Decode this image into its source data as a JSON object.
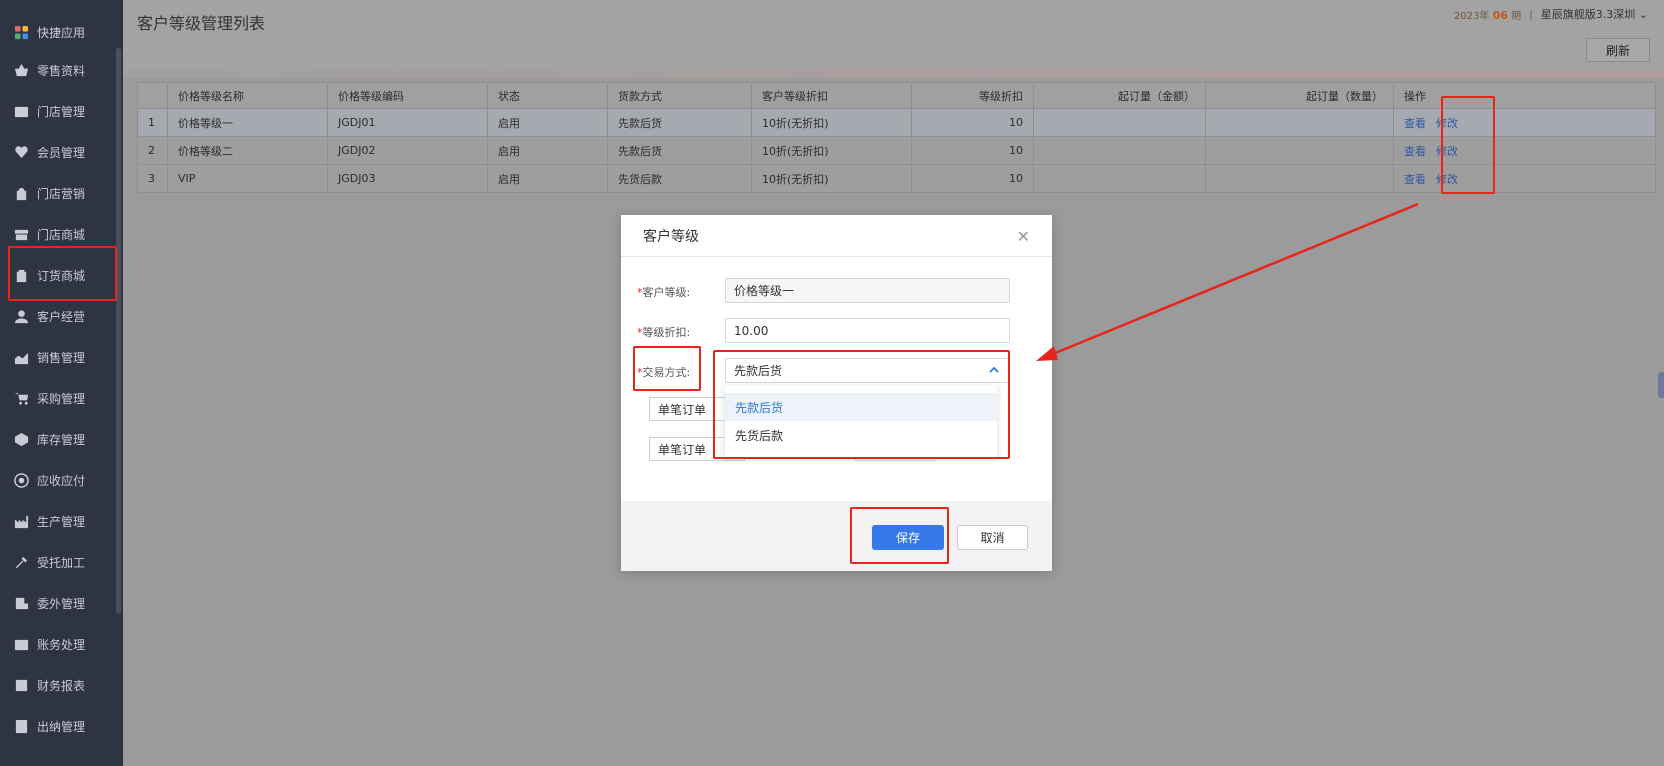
{
  "sidebar": {
    "items": [
      {
        "label": "快捷应用",
        "icon": "apps-icon"
      },
      {
        "label": "零售资料",
        "icon": "basket-icon"
      },
      {
        "label": "门店管理",
        "icon": "store-icon"
      },
      {
        "label": "会员管理",
        "icon": "heart-icon"
      },
      {
        "label": "门店营销",
        "icon": "bag-icon"
      },
      {
        "label": "门店商城",
        "icon": "shop-icon"
      },
      {
        "label": "订货商城",
        "icon": "order-bag-icon"
      },
      {
        "label": "客户经营",
        "icon": "user-icon"
      },
      {
        "label": "销售管理",
        "icon": "chart-icon"
      },
      {
        "label": "采购管理",
        "icon": "cart-icon"
      },
      {
        "label": "库存管理",
        "icon": "box-icon"
      },
      {
        "label": "应收应付",
        "icon": "target-icon"
      },
      {
        "label": "生产管理",
        "icon": "factory-icon"
      },
      {
        "label": "受托加工",
        "icon": "tools-icon"
      },
      {
        "label": "委外管理",
        "icon": "outsource-icon"
      },
      {
        "label": "账务处理",
        "icon": "ledger-icon"
      },
      {
        "label": "财务报表",
        "icon": "report-icon"
      },
      {
        "label": "出纳管理",
        "icon": "cashier-icon"
      }
    ]
  },
  "header": {
    "title": "客户等级管理列表",
    "date_prefix": "2023年",
    "date_day": "06",
    "date_suffix": "期",
    "separator": "|",
    "company": "星辰旗舰版3.3深圳",
    "refresh_label": "刷新"
  },
  "table": {
    "columns": [
      "",
      "价格等级名称",
      "价格等级编码",
      "状态",
      "货款方式",
      "客户等级折扣",
      "等级折扣",
      "起订量（金额）",
      "起订量（数量）",
      "操作"
    ],
    "rows": [
      {
        "no": "1",
        "name": "价格等级一",
        "code": "JGDJ01",
        "status": "启用",
        "payment": "先款后货",
        "discount_text": "10折(无折扣)",
        "discount": "10",
        "min_amount": "",
        "min_qty": "",
        "view": "查看",
        "edit": "修改"
      },
      {
        "no": "2",
        "name": "价格等级二",
        "code": "JGDJ02",
        "status": "启用",
        "payment": "先款后货",
        "discount_text": "10折(无折扣)",
        "discount": "10",
        "min_amount": "",
        "min_qty": "",
        "view": "查看",
        "edit": "修改"
      },
      {
        "no": "3",
        "name": "VIP",
        "code": "JGDJ03",
        "status": "启用",
        "payment": "先货后款",
        "discount_text": "10折(无折扣)",
        "discount": "10",
        "min_amount": "",
        "min_qty": "",
        "view": "查看",
        "edit": "修改"
      }
    ]
  },
  "modal": {
    "title": "客户等级",
    "required_mark": "*",
    "level_label": "客户等级:",
    "level_value": "价格等级一",
    "discount_label": "等级折扣:",
    "discount_value": "10.00",
    "trade_label": "交易方式:",
    "trade_value": "先款后货",
    "trade_options": [
      "先款后货",
      "先货后款"
    ],
    "single_order_1": "单笔订单",
    "single_order_2": "单笔订单",
    "save_label": "保存",
    "cancel_label": "取消"
  },
  "colors": {
    "accent": "#3778e8",
    "annotation_red": "#e8241c",
    "sidebar_bg": "#2f3442"
  }
}
